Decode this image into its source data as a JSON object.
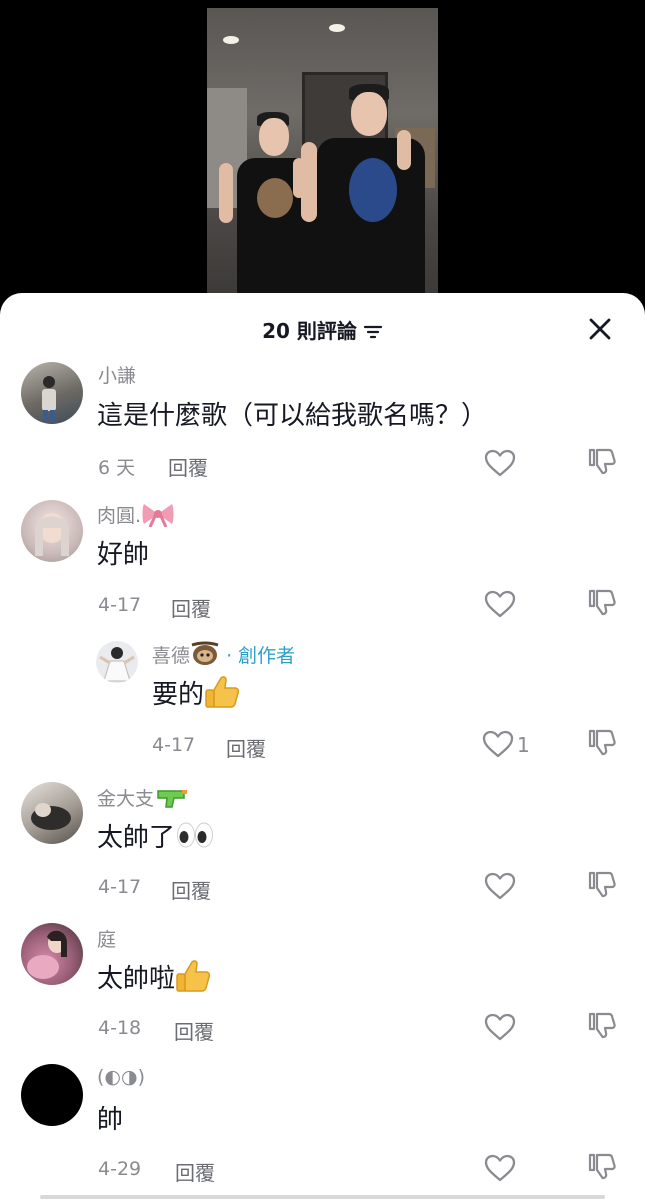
{
  "header": {
    "title": "20 則評論"
  },
  "comments": [
    {
      "user": "小謙",
      "text": "這是什麼歌（可以給我歌名嗎？）",
      "date": "6 天",
      "reply": "回覆",
      "likes": ""
    },
    {
      "user": "肉圓.",
      "text": "好帥",
      "date": "4-17",
      "reply": "回覆",
      "likes": ""
    },
    {
      "user": "喜德",
      "badge": "· 創作者",
      "text": "要的",
      "date": "4-17",
      "reply": "回覆",
      "likes": "1"
    },
    {
      "user": "金大支",
      "text": "太帥了",
      "date": "4-17",
      "reply": "回覆",
      "likes": ""
    },
    {
      "user": "庭",
      "text": "太帥啦",
      "date": "4-18",
      "reply": "回覆",
      "likes": ""
    },
    {
      "user": "(◐◑)",
      "text": "帥",
      "date": "4-29",
      "reply": "回覆",
      "likes": ""
    }
  ],
  "colors": {
    "creator": "#2ea0c8",
    "text": "#161823",
    "muted": "#8a8b91"
  },
  "icons": [
    "sort-icon",
    "close-icon",
    "heart-icon",
    "dislike-icon",
    "bow-emoji",
    "sloth-emoji",
    "thumbs-up-emoji",
    "water-gun-emoji",
    "eyes-emoji"
  ]
}
